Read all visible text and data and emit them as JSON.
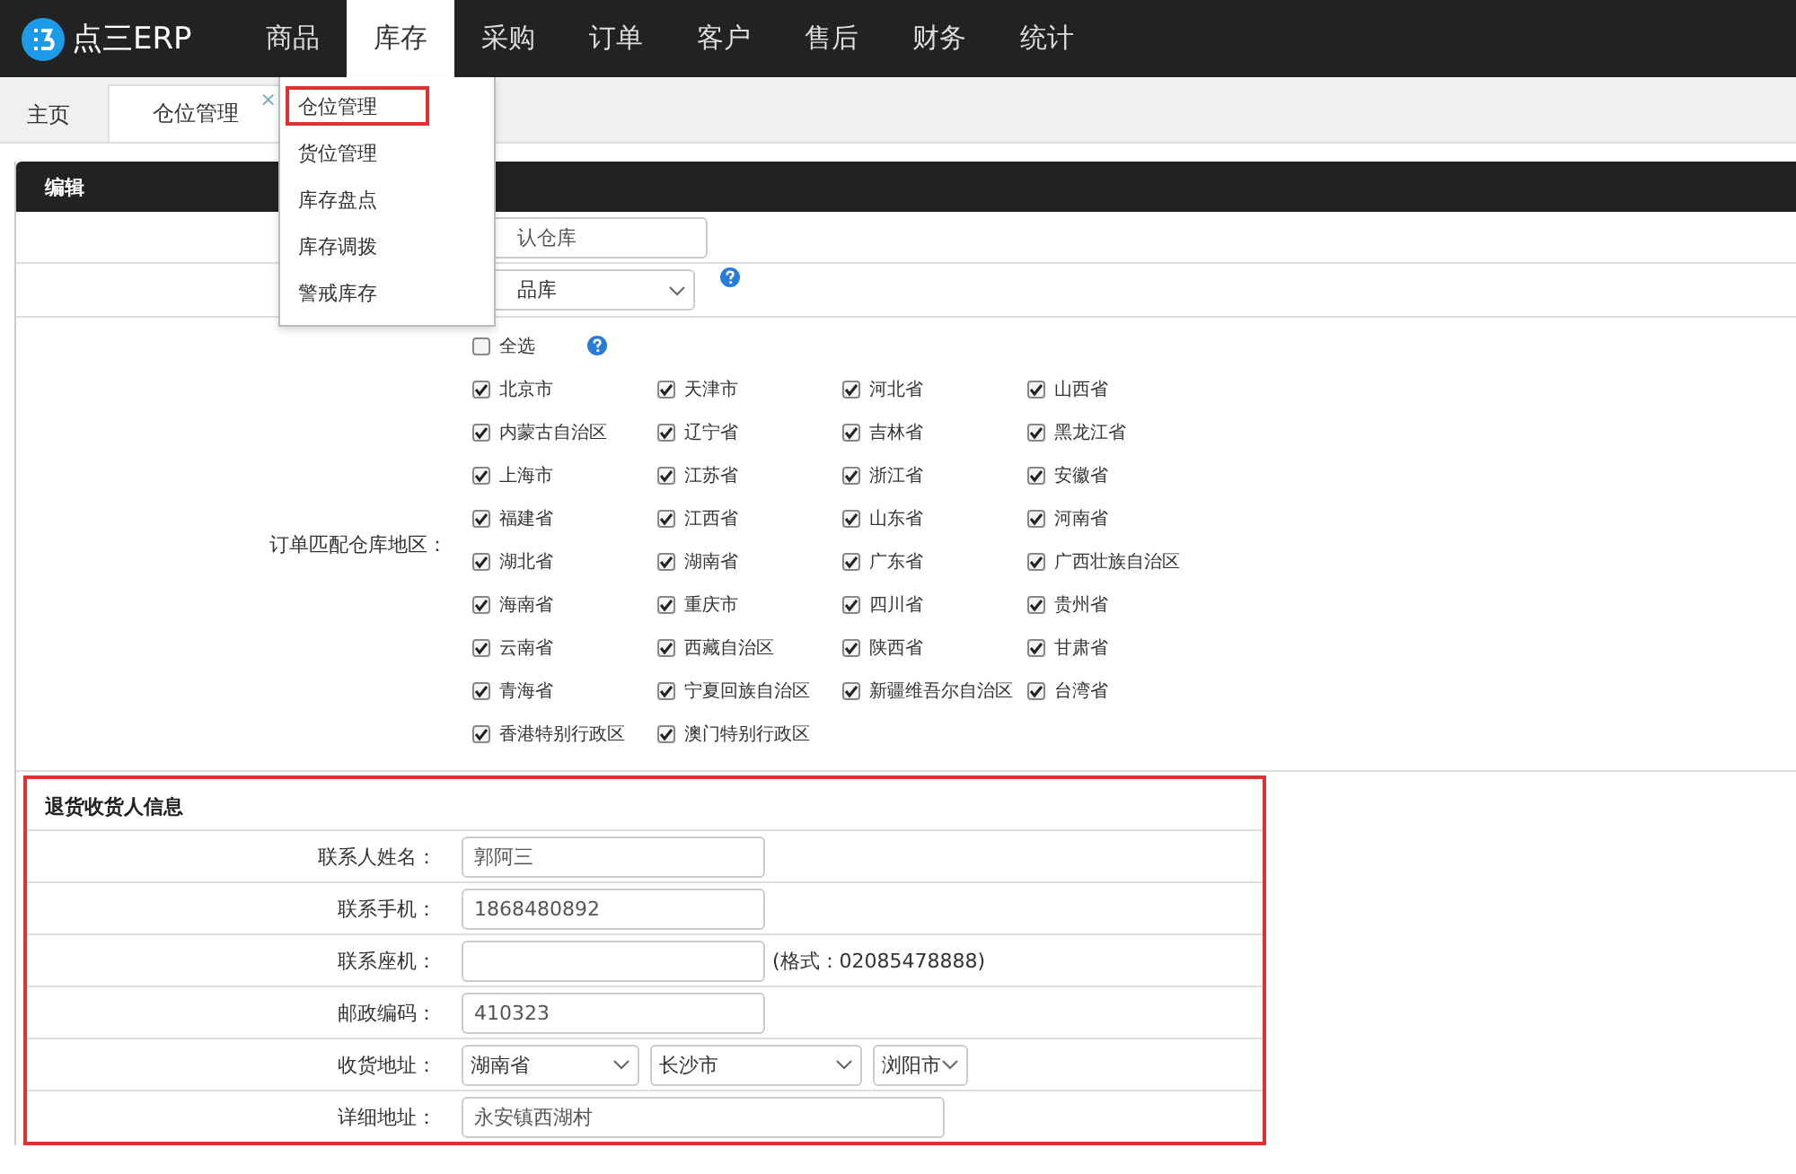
{
  "brand": {
    "name": "点三ERP"
  },
  "nav": [
    {
      "label": "商品",
      "selected": false
    },
    {
      "label": "库存",
      "selected": true
    },
    {
      "label": "采购",
      "selected": false
    },
    {
      "label": "订单",
      "selected": false
    },
    {
      "label": "客户",
      "selected": false
    },
    {
      "label": "售后",
      "selected": false
    },
    {
      "label": "财务",
      "selected": false
    },
    {
      "label": "统计",
      "selected": false
    }
  ],
  "menu": {
    "items": [
      {
        "label": "仓位管理",
        "selected": true
      },
      {
        "label": "货位管理",
        "selected": false
      },
      {
        "label": "库存盘点",
        "selected": false
      },
      {
        "label": "库存调拨",
        "selected": false
      },
      {
        "label": "警戒库存",
        "selected": false
      }
    ]
  },
  "tabs": [
    {
      "label": "主页",
      "selected": false
    },
    {
      "label": "仓位管理",
      "selected": true,
      "close": "×"
    }
  ],
  "panel": {
    "title": "编辑"
  },
  "form": {
    "rows": [
      {
        "kind": "input",
        "value": "认仓库"
      },
      {
        "kind": "select",
        "value": "品库",
        "help": true
      }
    ],
    "regions": {
      "label": "订单匹配仓库地区：",
      "select_all": {
        "label": "全选",
        "checked": false
      },
      "items": [
        {
          "label": "北京市",
          "checked": true
        },
        {
          "label": "天津市",
          "checked": true
        },
        {
          "label": "河北省",
          "checked": true
        },
        {
          "label": "山西省",
          "checked": true
        },
        {
          "label": "内蒙古自治区",
          "checked": true
        },
        {
          "label": "辽宁省",
          "checked": true
        },
        {
          "label": "吉林省",
          "checked": true
        },
        {
          "label": "黑龙江省",
          "checked": true
        },
        {
          "label": "上海市",
          "checked": true
        },
        {
          "label": "江苏省",
          "checked": true
        },
        {
          "label": "浙江省",
          "checked": true
        },
        {
          "label": "安徽省",
          "checked": true
        },
        {
          "label": "福建省",
          "checked": true
        },
        {
          "label": "江西省",
          "checked": true
        },
        {
          "label": "山东省",
          "checked": true
        },
        {
          "label": "河南省",
          "checked": true
        },
        {
          "label": "湖北省",
          "checked": true
        },
        {
          "label": "湖南省",
          "checked": true
        },
        {
          "label": "广东省",
          "checked": true
        },
        {
          "label": "广西壮族自治区",
          "checked": true
        },
        {
          "label": "海南省",
          "checked": true
        },
        {
          "label": "重庆市",
          "checked": true
        },
        {
          "label": "四川省",
          "checked": true
        },
        {
          "label": "贵州省",
          "checked": true
        },
        {
          "label": "云南省",
          "checked": true
        },
        {
          "label": "西藏自治区",
          "checked": true
        },
        {
          "label": "陕西省",
          "checked": true
        },
        {
          "label": "甘肃省",
          "checked": true
        },
        {
          "label": "青海省",
          "checked": true
        },
        {
          "label": "宁夏回族自治区",
          "checked": true
        },
        {
          "label": "新疆维吾尔自治区",
          "checked": true
        },
        {
          "label": "台湾省",
          "checked": true
        },
        {
          "label": "香港特别行政区",
          "checked": true
        },
        {
          "label": "澳门特别行政区",
          "checked": true
        }
      ]
    }
  },
  "return_contact": {
    "title": "退货收货人信息",
    "rows": [
      {
        "kind": "input",
        "label": "联系人姓名：",
        "value": "郭阿三"
      },
      {
        "kind": "input",
        "label": "联系手机：",
        "value": "1868480892"
      },
      {
        "kind": "input",
        "label": "联系座机：",
        "hint": "(格式：02085478888)"
      },
      {
        "kind": "input",
        "label": "邮政编码：",
        "value": "410323"
      },
      {
        "kind": "address",
        "label": "收货地址：",
        "selects": [
          "湖南省",
          "长沙市",
          "浏阳市"
        ]
      },
      {
        "kind": "wide",
        "label": "详细地址：",
        "value": "永安镇西湖村"
      }
    ]
  }
}
